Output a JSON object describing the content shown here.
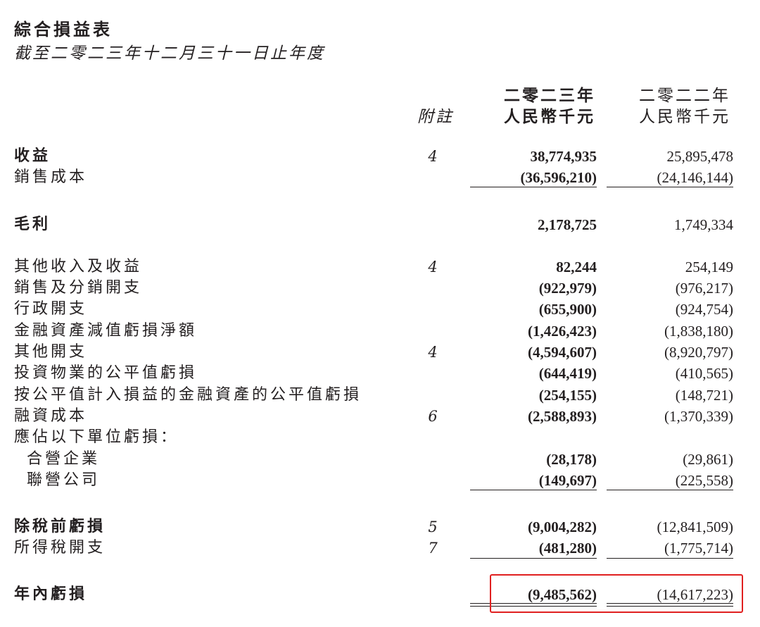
{
  "document": {
    "title": "綜合損益表",
    "subtitle": "截至二零二三年十二月三十一日止年度"
  },
  "header": {
    "note_label": "附註",
    "year_2023": "二零二三年",
    "currency_2023": "人民幣千元",
    "year_2022": "二零二二年",
    "currency_2022": "人民幣千元"
  },
  "rows": [
    {
      "label": "收益",
      "note": "4",
      "v2023": "38,774,935",
      "v2022": "25,895,478"
    },
    {
      "label": "銷售成本",
      "note": "",
      "v2023": "(36,596,210)",
      "v2022": "(24,146,144)"
    },
    {
      "label": "毛利",
      "note": "",
      "v2023": "2,178,725",
      "v2022": "1,749,334"
    },
    {
      "label": "其他收入及收益",
      "note": "4",
      "v2023": "82,244",
      "v2022": "254,149"
    },
    {
      "label": "銷售及分銷開支",
      "note": "",
      "v2023": "(922,979)",
      "v2022": "(976,217)"
    },
    {
      "label": "行政開支",
      "note": "",
      "v2023": "(655,900)",
      "v2022": "(924,754)"
    },
    {
      "label": "金融資產減值虧損淨額",
      "note": "",
      "v2023": "(1,426,423)",
      "v2022": "(1,838,180)"
    },
    {
      "label": "其他開支",
      "note": "4",
      "v2023": "(4,594,607)",
      "v2022": "(8,920,797)"
    },
    {
      "label": "投資物業的公平值虧損",
      "note": "",
      "v2023": "(644,419)",
      "v2022": "(410,565)"
    },
    {
      "label": "按公平值計入損益的金融資產的公平值虧損",
      "note": "",
      "v2023": "(254,155)",
      "v2022": "(148,721)"
    },
    {
      "label": "融資成本",
      "note": "6",
      "v2023": "(2,588,893)",
      "v2022": "(1,370,339)"
    },
    {
      "label": "應佔以下單位虧損：",
      "note": "",
      "v2023": "",
      "v2022": ""
    },
    {
      "label": "合營企業",
      "note": "",
      "v2023": "(28,178)",
      "v2022": "(29,861)"
    },
    {
      "label": "聯營公司",
      "note": "",
      "v2023": "(149,697)",
      "v2022": "(225,558)"
    },
    {
      "label": "除稅前虧損",
      "note": "5",
      "v2023": "(9,004,282)",
      "v2022": "(12,841,509)"
    },
    {
      "label": "所得稅開支",
      "note": "7",
      "v2023": "(481,280)",
      "v2022": "(1,775,714)"
    },
    {
      "label": "年內虧損",
      "note": "",
      "v2023": "(9,485,562)",
      "v2022": "(14,617,223)"
    }
  ],
  "colors": {
    "text": "#231f20",
    "highlight_border": "#e02020"
  }
}
